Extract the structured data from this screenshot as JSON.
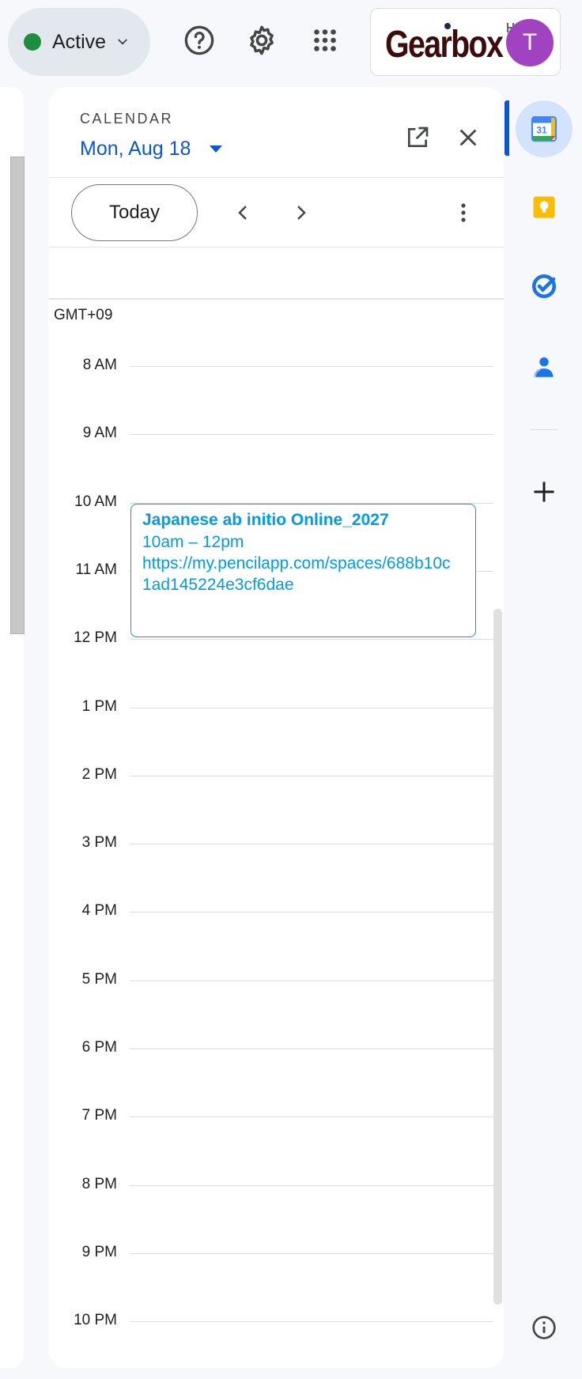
{
  "topbar": {
    "status_label": "Active",
    "brand": "Gearbox",
    "avatar_initial": "T",
    "icons": [
      "help-icon",
      "settings-gear-icon",
      "apps-grid-icon"
    ]
  },
  "calendar": {
    "kicker": "CALENDAR",
    "date": "Mon, Aug 18",
    "today_label": "Today",
    "timezone": "GMT+09",
    "hours": [
      "8 AM",
      "9 AM",
      "10 AM",
      "11 AM",
      "12 PM",
      "1 PM",
      "2 PM",
      "3 PM",
      "4 PM",
      "5 PM",
      "6 PM",
      "7 PM",
      "8 PM",
      "9 PM",
      "10 PM"
    ],
    "event": {
      "title": "Japanese ab initio Online_2027",
      "time": "10am – 12pm",
      "link_line1": "https://my.pencilapp.com/spaces/688b10c",
      "link_line2": "1ad145224e3cf6dae",
      "color": "#039be5"
    }
  },
  "rail": {
    "items": [
      "calendar-icon",
      "keep-icon",
      "tasks-icon",
      "contacts-icon",
      "add-icon",
      "info-icon"
    ],
    "calendar_day": "31"
  },
  "colors": {
    "accent": "#0b57d0",
    "status_green": "#1e8e3e",
    "avatar": "#a142c0"
  }
}
